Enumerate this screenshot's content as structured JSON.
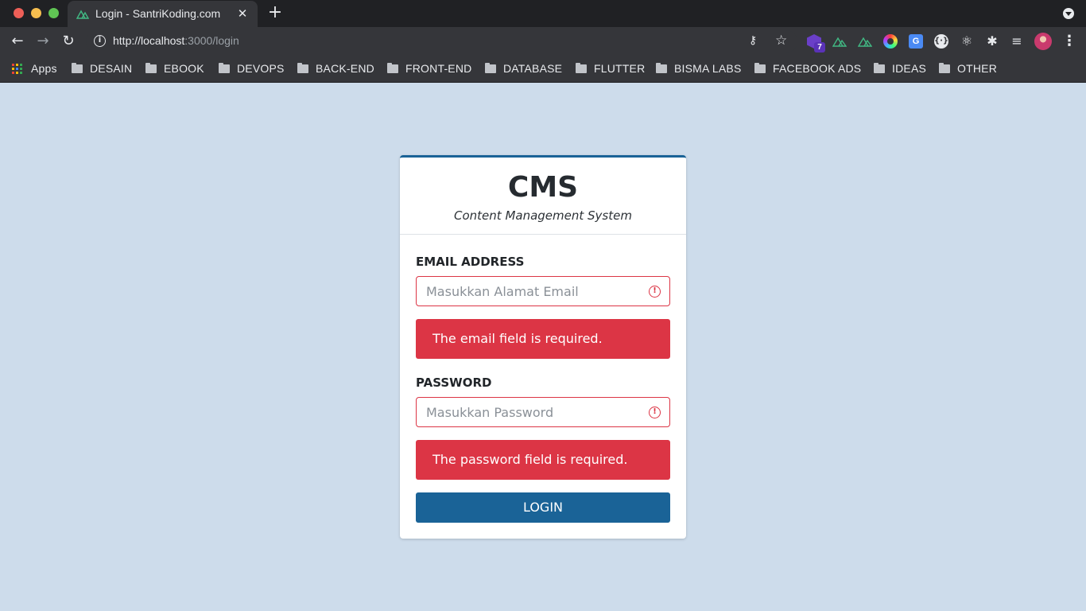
{
  "browser": {
    "tab_title": "Login - SantriKoding.com",
    "new_tab_symbol": "+",
    "url_host": "http://localhost",
    "url_path": ":3000/login",
    "extension_badge": "7"
  },
  "bookmarks": {
    "apps_label": "Apps",
    "folders": [
      "DESAIN",
      "EBOOK",
      "DEVOPS",
      "BACK-END",
      "FRONT-END",
      "DATABASE",
      "FLUTTER",
      "BISMA LABS",
      "FACEBOOK ADS",
      "IDEAS",
      "OTHER"
    ]
  },
  "card": {
    "title": "CMS",
    "subtitle": "Content Management System"
  },
  "form": {
    "email_label": "EMAIL ADDRESS",
    "email_placeholder": "Masukkan Alamat Email",
    "email_value": "",
    "email_error": "The email field is required.",
    "password_label": "PASSWORD",
    "password_placeholder": "Masukkan Password",
    "password_value": "",
    "password_error": "The password field is required.",
    "submit_label": "LOGIN"
  },
  "colors": {
    "page_background": "#cddceb",
    "primary": "#1a6397",
    "danger": "#dc3545"
  }
}
